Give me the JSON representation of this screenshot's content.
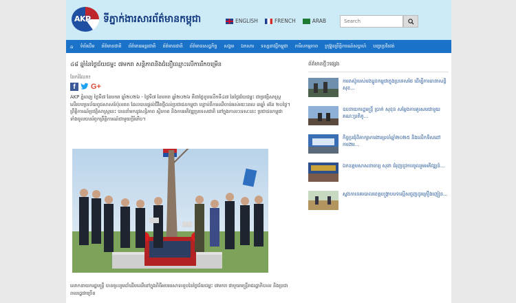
{
  "site": {
    "logo_text": "AKP",
    "name": "ទីភ្នាក់ងារសារព័ត៌មានកម្ពុជា"
  },
  "languages": [
    {
      "label": "ENGLISH"
    },
    {
      "label": "FRENCH"
    },
    {
      "label": "ARAB"
    }
  ],
  "search": {
    "placeholder": "Search"
  },
  "nav": [
    {
      "label": "ទំព័រដើម"
    },
    {
      "label": "ព័ត៌មានជាតិ"
    },
    {
      "label": "ព័ត៌មានអន្តរជាតិ"
    },
    {
      "label": "ព័ត៌មានជាតិ"
    },
    {
      "label": "ព័ត៌មានសេដ្ឋកិច្ច"
    },
    {
      "label": "សង្គម"
    },
    {
      "label": "ឯកសារ"
    },
    {
      "label": "ទស្សនាវដ្ដីកម្ពុជា"
    },
    {
      "label": "ការីសកម្មភាព"
    },
    {
      "label": "ក្រុម្ហ៊ុនព្រឹត្តិការណ៍សប្តាហ៍"
    },
    {
      "label": "បញ្ហាប្រវិនវត់"
    }
  ],
  "article": {
    "title": "៤៨ ឆ្នាំនៃថ្ងៃជ័យជម្នះ ៧មករា សន្តិភាពនិងជំនឿឈ្មោះលើការរីកចម្រើន",
    "share_label": "ចែករំលែក៖",
    "paragraph": "AKP ភ្នំពេញ ថ្ងៃទី៧ ខែមករា ឆ្នាំ២០២៦ - ថ្ងៃទី៧ ខែមករា ឆ្នាំ២០២៦ គឺជាថ្ងៃខួបលើកទី៤៧ នៃថ្ងៃជ័យជម្នះ ជាប្រវត្តិសាស្ត្រ លើរបបប្រល័យពូជសាសន៍ប៉ុលពត ដែលបានផ្តល់ជីវិតថ្មីដល់ប្រជាជនកម្ពុជា បន្ទាប់ពីការឈឺចាប់អស់រយៈពេល ៣ឆ្នាំ ៨ខែ ២០ថ្ងៃ។ ព្រឹត្តិការណ៍ប្រវត្តិសាស្ត្រនេះ បាននាំមកនូវសន្តិភាព ស្ថិរភាព និងការអភិវឌ្ឍប្រទេសជាតិ នៅក្នុងកាលៈទេសៈនេះ ប្រជាជនកម្ពុជាទាំងមូលបានរំឭកព្រឹត្តិការណ៍ជាមួយក្ដីរំភើប។",
    "caption": "លោកនាយករដ្ឋមន្ត្រី បានចូលរួមដាំដើមឈើនៅក្នុងពិធីអបអរសាទរខួបនៃថ្ងៃជ័យជម្នះ ៧មករា ជាមួយមន្ត្រីរាជរដ្ឋាភិបាល និងប្រជាពលរដ្ឋជាច្រើន"
  },
  "sidebar": {
    "title": "ព័ត៌មានថ្មីៗផ្សេង",
    "items": [
      {
        "text": "ការតស៊ូរបស់បងប្អូនកម្ពុជាក្នុងប្រទេសថៃ ដើម្បីការធានាសន្តិសុខ..."
      },
      {
        "text": "ឧបនាយករដ្ឋមន្ត្រី ប្រាក់ សុខុន សម្តែងការគួរសមជាមួយគណៈប្រតិភូ..."
      },
      {
        "text": "កិច្ចប្រជុំពិភាក្សាការងារប្រចាំឆ្នាំ២០២៥ និងលើកទិសដៅការងារ..."
      },
      {
        "text": "ឯកឧត្តមសាសនាចារ្យ សុខា ជំរុញនូវការចូលរួមអភិវឌ្ឍន៍..."
      },
      {
        "text": "ស្នងការនគរបាលខេត្តបង្ក្រាបបទល្មើសជួញដូរគ្រឿងញៀន..."
      }
    ]
  }
}
